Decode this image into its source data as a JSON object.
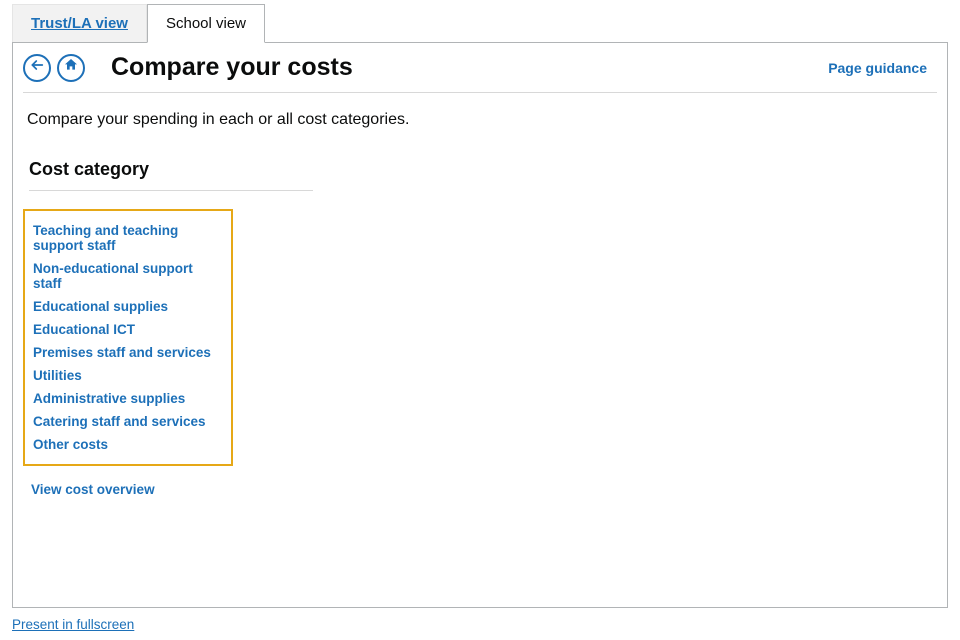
{
  "tabs": {
    "trust_la": "Trust/LA view",
    "school": "School view"
  },
  "header": {
    "title": "Compare your costs",
    "guidance": "Page guidance"
  },
  "intro": "Compare your spending in each or all cost categories.",
  "section_title": "Cost category",
  "categories": [
    "Teaching and teaching support staff",
    "Non-educational support staff",
    "Educational supplies",
    "Educational ICT",
    "Premises staff and services",
    "Utilities",
    "Administrative supplies",
    "Catering staff and services",
    "Other costs"
  ],
  "overview_link": "View cost overview",
  "fullscreen": "Present in fullscreen"
}
